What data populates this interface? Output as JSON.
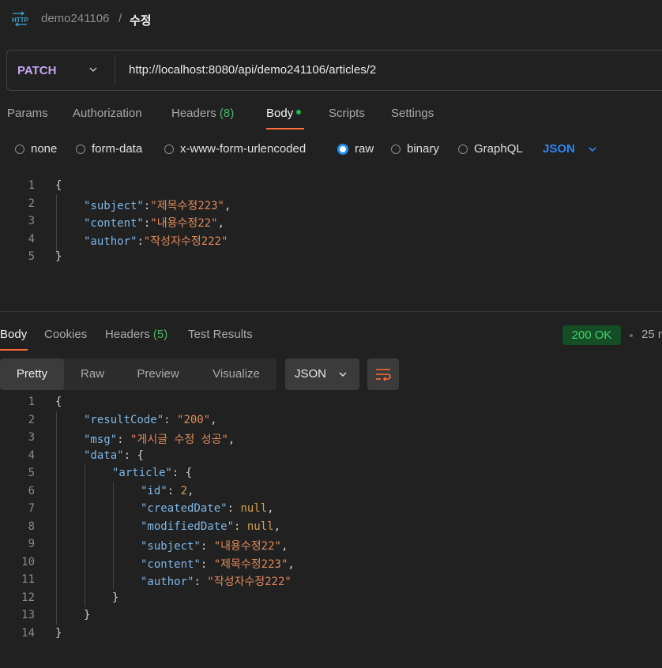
{
  "breadcrumb": {
    "collection": "demo241106",
    "separator": "/",
    "request": "수정"
  },
  "request": {
    "method": "PATCH",
    "url": "http://localhost:8080/api/demo241106/articles/2",
    "tabs": {
      "params": "Params",
      "authorization": "Authorization",
      "headers": "Headers",
      "headers_count": "(8)",
      "body": "Body",
      "scripts": "Scripts",
      "settings": "Settings"
    },
    "body_types": {
      "none": "none",
      "form_data": "form-data",
      "urlencoded": "x-www-form-urlencoded",
      "raw": "raw",
      "binary": "binary",
      "graphql": "GraphQL"
    },
    "selected_body_type": "raw",
    "format": "JSON",
    "body_lines": [
      {
        "n": "1",
        "text": "{"
      },
      {
        "n": "2",
        "key": "\"subject\"",
        "sep": ":",
        "val": "\"제목수정223\"",
        "end": ","
      },
      {
        "n": "3",
        "key": "\"content\"",
        "sep": ":",
        "val": "\"내용수정22\"",
        "end": ","
      },
      {
        "n": "4",
        "key": "\"author\"",
        "sep": ":",
        "val": "\"작성자수정222\"",
        "end": ""
      },
      {
        "n": "5",
        "text": "}"
      }
    ]
  },
  "response": {
    "tabs": {
      "body": "Body",
      "cookies": "Cookies",
      "headers": "Headers",
      "headers_count": "(5)",
      "test_results": "Test Results"
    },
    "status": "200 OK",
    "time": "25 r",
    "view_tabs": {
      "pretty": "Pretty",
      "raw": "Raw",
      "preview": "Preview",
      "visualize": "Visualize"
    },
    "format": "JSON",
    "lines": [
      {
        "n": "1",
        "indent": 0,
        "text": "{"
      },
      {
        "n": "2",
        "indent": 1,
        "key": "\"resultCode\"",
        "sep": ": ",
        "val": "\"200\"",
        "vtype": "s",
        "end": ","
      },
      {
        "n": "3",
        "indent": 1,
        "key": "\"msg\"",
        "sep": ": ",
        "val": "\"게시글 수정 성공\"",
        "vtype": "s",
        "end": ","
      },
      {
        "n": "4",
        "indent": 1,
        "key": "\"data\"",
        "sep": ": ",
        "val": "{",
        "vtype": "p",
        "end": ""
      },
      {
        "n": "5",
        "indent": 2,
        "key": "\"article\"",
        "sep": ": ",
        "val": "{",
        "vtype": "p",
        "end": ""
      },
      {
        "n": "6",
        "indent": 3,
        "key": "\"id\"",
        "sep": ": ",
        "val": "2",
        "vtype": "n",
        "end": ","
      },
      {
        "n": "7",
        "indent": 3,
        "key": "\"createdDate\"",
        "sep": ": ",
        "val": "null",
        "vtype": "n",
        "end": ","
      },
      {
        "n": "8",
        "indent": 3,
        "key": "\"modifiedDate\"",
        "sep": ": ",
        "val": "null",
        "vtype": "n",
        "end": ","
      },
      {
        "n": "9",
        "indent": 3,
        "key": "\"subject\"",
        "sep": ": ",
        "val": "\"내용수정22\"",
        "vtype": "s",
        "end": ","
      },
      {
        "n": "10",
        "indent": 3,
        "key": "\"content\"",
        "sep": ": ",
        "val": "\"제목수정223\"",
        "vtype": "s",
        "end": ","
      },
      {
        "n": "11",
        "indent": 3,
        "key": "\"author\"",
        "sep": ": ",
        "val": "\"작성자수정222\"",
        "vtype": "s",
        "end": ""
      },
      {
        "n": "12",
        "indent": 2,
        "text": "}"
      },
      {
        "n": "13",
        "indent": 1,
        "text": "}"
      },
      {
        "n": "14",
        "indent": 0,
        "text": "}"
      }
    ]
  },
  "colors": {
    "accent": "#ff6c37",
    "method": "#c4a6f0",
    "json_key": "#7fb6e6",
    "json_string": "#e08a5a",
    "status_bg": "#144d26",
    "status_text": "#43d16c"
  },
  "icons": [
    "http-icon",
    "chevron-down-icon",
    "wrap-lines-icon"
  ]
}
